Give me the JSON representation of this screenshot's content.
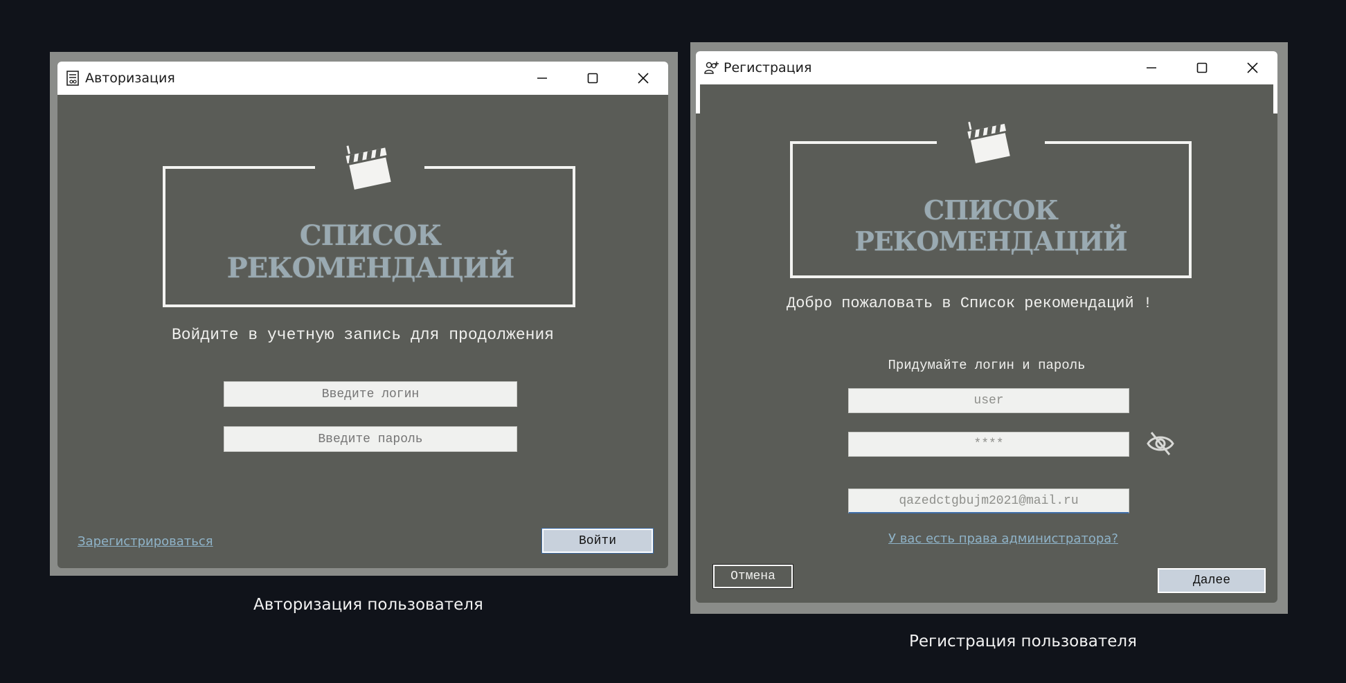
{
  "login_window": {
    "title": "Авторизация",
    "logo_text": "СПИСОК РЕКОМЕНДАЦИЙ",
    "heading": "Войдите в учетную запись для продолжения",
    "login_placeholder": "Введите логин",
    "password_placeholder": "Введите пароль",
    "register_link": "Зарегистрироваться",
    "login_button": "Войти",
    "caption": "Авторизация пользователя"
  },
  "register_window": {
    "title": "Регистрация",
    "logo_text": "СПИСОК РЕКОМЕНДАЦИЙ",
    "welcome": "Добро пожаловать в Список рекомендаций !",
    "prompt": "Придумайте логин и пароль",
    "login_value": "user",
    "password_value": "****",
    "email_value": "qazedctgbujm2021@mail.ru",
    "admin_link": "У вас есть права администратора?",
    "cancel_button": "Отмена",
    "next_button": "Далее",
    "caption": "Регистрация пользователя"
  },
  "icons": {
    "login_title_icon": "document-icon",
    "register_title_icon": "users-icon",
    "minimize": "minimize-icon",
    "maximize": "maximize-icon",
    "close": "close-icon",
    "clapperboard": "clapperboard-icon",
    "password_visibility": "eye-off-icon"
  },
  "colors": {
    "page_bg": "#10131a",
    "window_bg": "#5a5c57",
    "accent_link": "#8fb3c8",
    "logo_text": "#9aaab2"
  }
}
